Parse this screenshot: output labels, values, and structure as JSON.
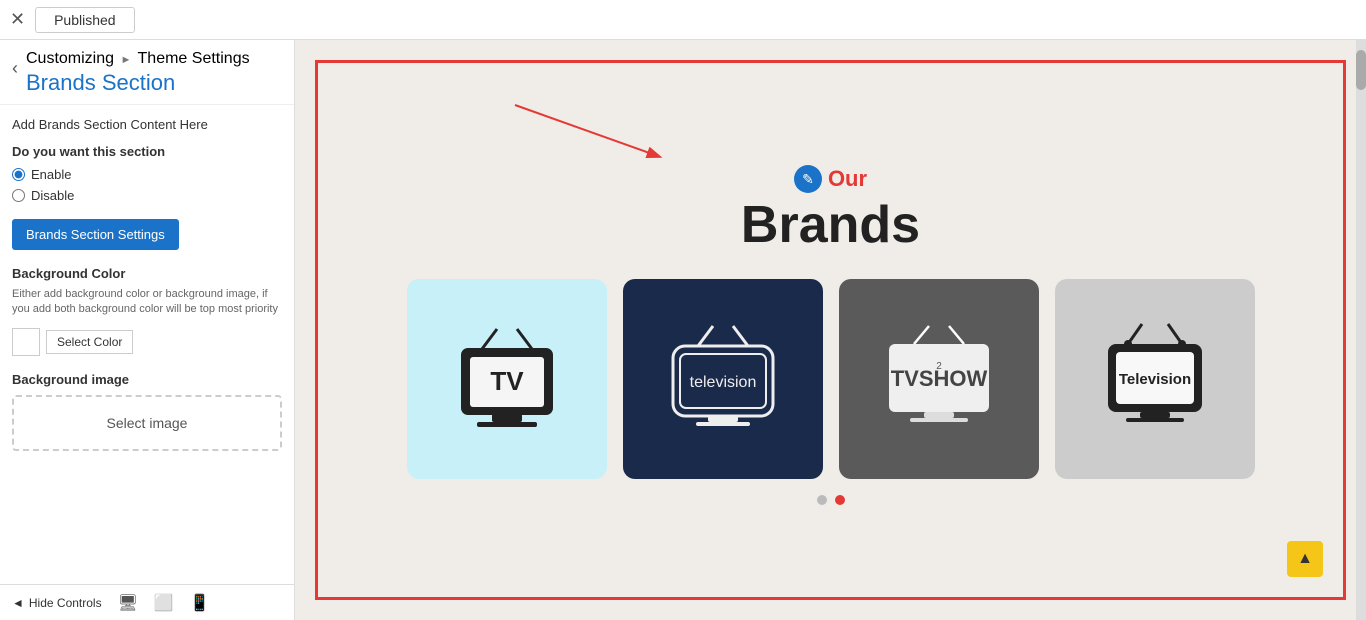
{
  "topbar": {
    "close_icon": "✕",
    "published_label": "Published"
  },
  "sidebar": {
    "back_icon": "‹",
    "breadcrumb": "Customizing",
    "breadcrumb_separator": "►",
    "breadcrumb_section": "Theme Settings",
    "section_title": "Brands Section",
    "add_content_label": "Add Brands Section Content Here",
    "section_question": "Do you want this section",
    "enable_label": "Enable",
    "disable_label": "Disable",
    "settings_button": "Brands Section Settings",
    "bg_color_heading": "Background Color",
    "bg_color_desc": "Either add background color or background image, if you add both background color will be top most priority",
    "select_color_label": "Select Color",
    "bg_image_heading": "Background image",
    "select_image_label": "Select image",
    "hide_controls_label": "Hide Controls"
  },
  "preview": {
    "our_label": "Our",
    "brands_title": "Brands",
    "edit_icon": "✎",
    "dots": [
      {
        "active": false
      },
      {
        "active": true
      }
    ]
  },
  "brands": [
    {
      "id": 1,
      "bg": "#c8f0f8",
      "style": "light"
    },
    {
      "id": 2,
      "bg": "#1a2a4a",
      "style": "dark"
    },
    {
      "id": 3,
      "bg": "#5a5a5a",
      "style": "dark"
    },
    {
      "id": 4,
      "bg": "#cccccc",
      "style": "medium"
    }
  ]
}
